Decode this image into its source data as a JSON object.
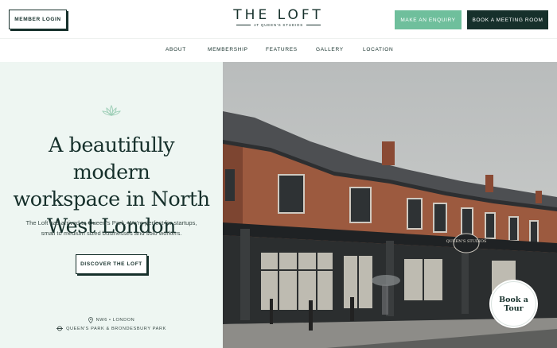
{
  "header": {
    "member_login": "MEMBER LOGIN",
    "logo_title": "THE LOFT",
    "logo_subtitle": "AT QUEEN'S STUDIOS",
    "enquiry": "MAKE AN ENQUIRY",
    "meeting": "BOOK A MEETING ROOM"
  },
  "nav": {
    "items": [
      "ABOUT",
      "MEMBERSHIP",
      "FEATURES",
      "GALLERY",
      "LOCATION"
    ]
  },
  "hero": {
    "title_lines": [
      "A beautifully modern",
      "workspace in North",
      "West London"
    ],
    "text_lines": [
      "The Loft has arrived to Queen's Park. We're perfect for startups,",
      "small to medium sized businesses and solo workers."
    ],
    "cta": "DISCOVER THE LOFT",
    "location": "NW6 • LONDON",
    "transport": "QUEEN'S PARK & BRONDESBURY PARK"
  },
  "photo": {
    "sign_text": "QUEEN'S STUDIOS"
  },
  "badge": {
    "line1": "Book a",
    "line2": "Tour"
  },
  "colors": {
    "brand_dark": "#16302b",
    "accent_green": "#6fbf9c",
    "panel_bg": "#eef6f2"
  }
}
